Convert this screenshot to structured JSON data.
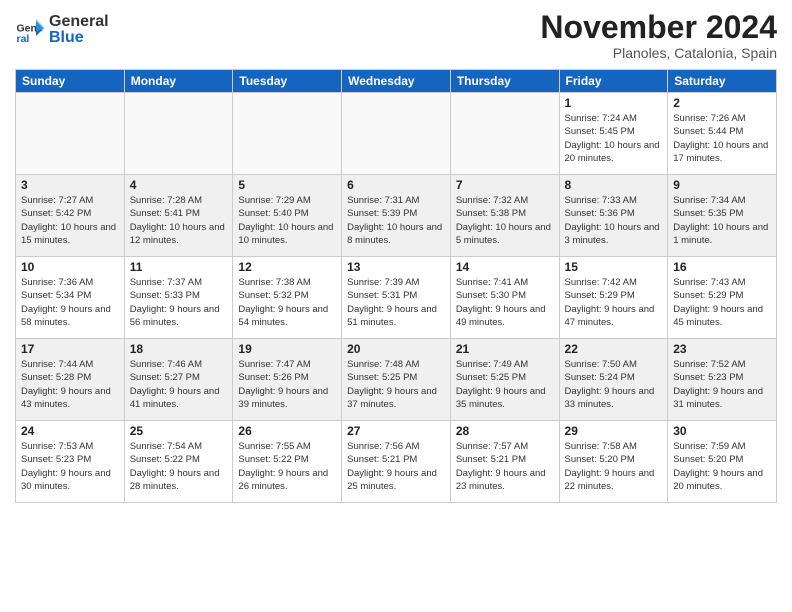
{
  "header": {
    "logo_general": "General",
    "logo_blue": "Blue",
    "month_title": "November 2024",
    "location": "Planoles, Catalonia, Spain"
  },
  "days_of_week": [
    "Sunday",
    "Monday",
    "Tuesday",
    "Wednesday",
    "Thursday",
    "Friday",
    "Saturday"
  ],
  "weeks": [
    {
      "shaded": false,
      "days": [
        {
          "num": "",
          "info": ""
        },
        {
          "num": "",
          "info": ""
        },
        {
          "num": "",
          "info": ""
        },
        {
          "num": "",
          "info": ""
        },
        {
          "num": "",
          "info": ""
        },
        {
          "num": "1",
          "info": "Sunrise: 7:24 AM\nSunset: 5:45 PM\nDaylight: 10 hours and 20 minutes."
        },
        {
          "num": "2",
          "info": "Sunrise: 7:26 AM\nSunset: 5:44 PM\nDaylight: 10 hours and 17 minutes."
        }
      ]
    },
    {
      "shaded": true,
      "days": [
        {
          "num": "3",
          "info": "Sunrise: 7:27 AM\nSunset: 5:42 PM\nDaylight: 10 hours and 15 minutes."
        },
        {
          "num": "4",
          "info": "Sunrise: 7:28 AM\nSunset: 5:41 PM\nDaylight: 10 hours and 12 minutes."
        },
        {
          "num": "5",
          "info": "Sunrise: 7:29 AM\nSunset: 5:40 PM\nDaylight: 10 hours and 10 minutes."
        },
        {
          "num": "6",
          "info": "Sunrise: 7:31 AM\nSunset: 5:39 PM\nDaylight: 10 hours and 8 minutes."
        },
        {
          "num": "7",
          "info": "Sunrise: 7:32 AM\nSunset: 5:38 PM\nDaylight: 10 hours and 5 minutes."
        },
        {
          "num": "8",
          "info": "Sunrise: 7:33 AM\nSunset: 5:36 PM\nDaylight: 10 hours and 3 minutes."
        },
        {
          "num": "9",
          "info": "Sunrise: 7:34 AM\nSunset: 5:35 PM\nDaylight: 10 hours and 1 minute."
        }
      ]
    },
    {
      "shaded": false,
      "days": [
        {
          "num": "10",
          "info": "Sunrise: 7:36 AM\nSunset: 5:34 PM\nDaylight: 9 hours and 58 minutes."
        },
        {
          "num": "11",
          "info": "Sunrise: 7:37 AM\nSunset: 5:33 PM\nDaylight: 9 hours and 56 minutes."
        },
        {
          "num": "12",
          "info": "Sunrise: 7:38 AM\nSunset: 5:32 PM\nDaylight: 9 hours and 54 minutes."
        },
        {
          "num": "13",
          "info": "Sunrise: 7:39 AM\nSunset: 5:31 PM\nDaylight: 9 hours and 51 minutes."
        },
        {
          "num": "14",
          "info": "Sunrise: 7:41 AM\nSunset: 5:30 PM\nDaylight: 9 hours and 49 minutes."
        },
        {
          "num": "15",
          "info": "Sunrise: 7:42 AM\nSunset: 5:29 PM\nDaylight: 9 hours and 47 minutes."
        },
        {
          "num": "16",
          "info": "Sunrise: 7:43 AM\nSunset: 5:29 PM\nDaylight: 9 hours and 45 minutes."
        }
      ]
    },
    {
      "shaded": true,
      "days": [
        {
          "num": "17",
          "info": "Sunrise: 7:44 AM\nSunset: 5:28 PM\nDaylight: 9 hours and 43 minutes."
        },
        {
          "num": "18",
          "info": "Sunrise: 7:46 AM\nSunset: 5:27 PM\nDaylight: 9 hours and 41 minutes."
        },
        {
          "num": "19",
          "info": "Sunrise: 7:47 AM\nSunset: 5:26 PM\nDaylight: 9 hours and 39 minutes."
        },
        {
          "num": "20",
          "info": "Sunrise: 7:48 AM\nSunset: 5:25 PM\nDaylight: 9 hours and 37 minutes."
        },
        {
          "num": "21",
          "info": "Sunrise: 7:49 AM\nSunset: 5:25 PM\nDaylight: 9 hours and 35 minutes."
        },
        {
          "num": "22",
          "info": "Sunrise: 7:50 AM\nSunset: 5:24 PM\nDaylight: 9 hours and 33 minutes."
        },
        {
          "num": "23",
          "info": "Sunrise: 7:52 AM\nSunset: 5:23 PM\nDaylight: 9 hours and 31 minutes."
        }
      ]
    },
    {
      "shaded": false,
      "days": [
        {
          "num": "24",
          "info": "Sunrise: 7:53 AM\nSunset: 5:23 PM\nDaylight: 9 hours and 30 minutes."
        },
        {
          "num": "25",
          "info": "Sunrise: 7:54 AM\nSunset: 5:22 PM\nDaylight: 9 hours and 28 minutes."
        },
        {
          "num": "26",
          "info": "Sunrise: 7:55 AM\nSunset: 5:22 PM\nDaylight: 9 hours and 26 minutes."
        },
        {
          "num": "27",
          "info": "Sunrise: 7:56 AM\nSunset: 5:21 PM\nDaylight: 9 hours and 25 minutes."
        },
        {
          "num": "28",
          "info": "Sunrise: 7:57 AM\nSunset: 5:21 PM\nDaylight: 9 hours and 23 minutes."
        },
        {
          "num": "29",
          "info": "Sunrise: 7:58 AM\nSunset: 5:20 PM\nDaylight: 9 hours and 22 minutes."
        },
        {
          "num": "30",
          "info": "Sunrise: 7:59 AM\nSunset: 5:20 PM\nDaylight: 9 hours and 20 minutes."
        }
      ]
    }
  ]
}
